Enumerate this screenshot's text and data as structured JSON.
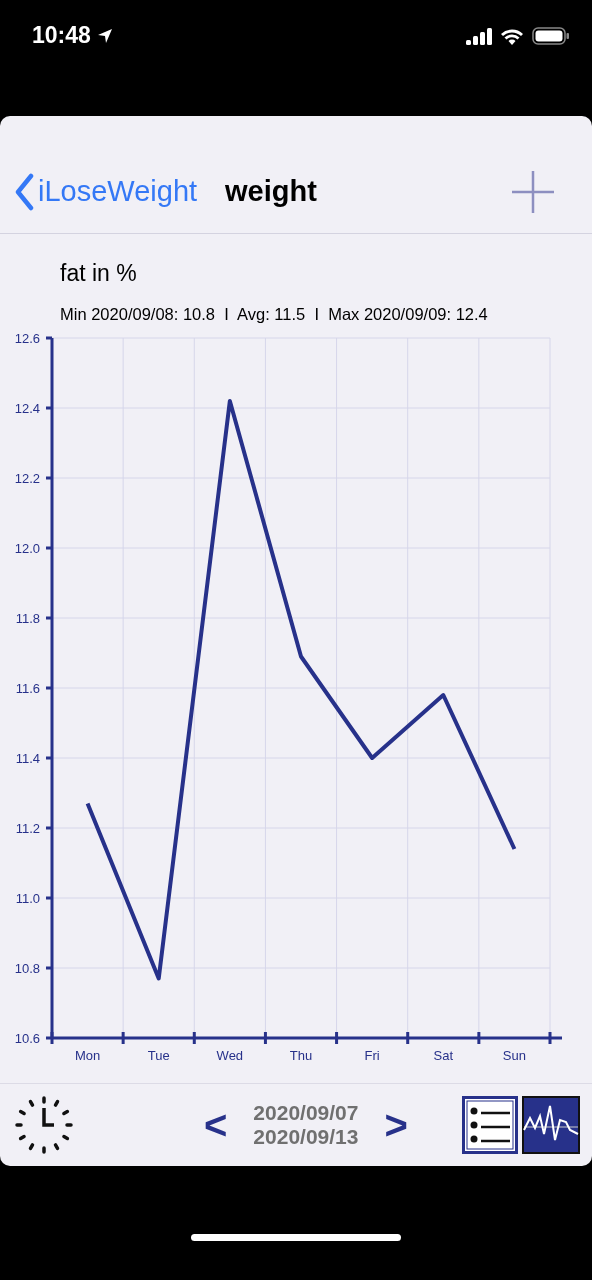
{
  "status_bar": {
    "time": "10:48"
  },
  "nav_bar": {
    "back": "iLoseWeight",
    "title": "weight"
  },
  "stats": "Min 2020/09/08: 10.8  I  Avg: 11.5  I  Max 2020/09/09: 12.4",
  "chart_data": {
    "type": "line",
    "title": "fat in %",
    "categories": [
      "Mon",
      "Tue",
      "Wed",
      "Thu",
      "Fri",
      "Sat",
      "Sun"
    ],
    "grid": true,
    "series": [
      {
        "color": "#27318a",
        "values": [
          11.27,
          10.77,
          12.42,
          11.69,
          11.4,
          11.58,
          11.14
        ]
      }
    ],
    "ylim": [
      10.6,
      12.6
    ],
    "yticks": [
      {
        "value": 10.6,
        "label": "10.6"
      },
      {
        "value": 10.8,
        "label": "10.8"
      },
      {
        "value": 11.0,
        "label": "11.0"
      },
      {
        "value": 11.2,
        "label": "11.2"
      },
      {
        "value": 11.4,
        "label": "11.4"
      },
      {
        "value": 11.6,
        "label": "11.6"
      },
      {
        "value": 11.8,
        "label": "11.8"
      },
      {
        "value": 12.0,
        "label": "12.0"
      },
      {
        "value": 12.2,
        "label": "12.2"
      },
      {
        "value": 12.4,
        "label": "12.4"
      },
      {
        "value": 12.6,
        "label": "12.6"
      }
    ]
  },
  "toolbar": {
    "prev": "<",
    "date_from": "2020/09/07",
    "date_to": "2020/09/13",
    "next": ">"
  }
}
